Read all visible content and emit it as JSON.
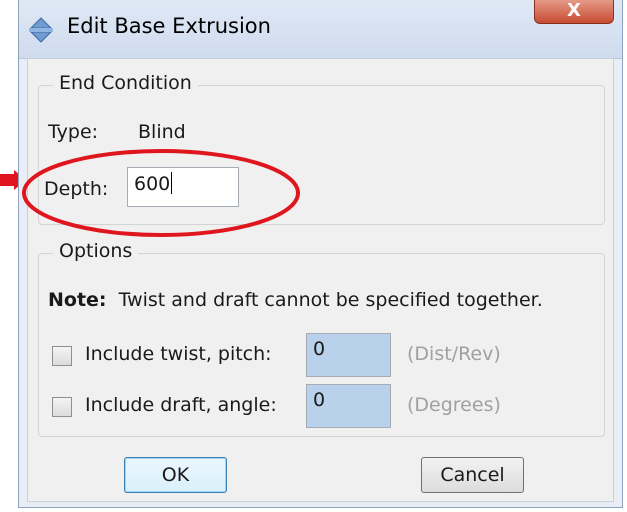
{
  "window": {
    "title": "Edit Base Extrusion",
    "close_glyph": "X",
    "icon": "extrude-icon"
  },
  "end_condition": {
    "group_label": "End Condition",
    "type_label": "Type:",
    "type_value": "Blind",
    "depth_label": "Depth:",
    "depth_value": "600"
  },
  "options": {
    "group_label": "Options",
    "note_label": "Note:",
    "note_text": "Twist and draft cannot be specified together.",
    "twist": {
      "label": "Include twist, pitch:",
      "value": "0",
      "unit": "(Dist/Rev)",
      "checked": false
    },
    "draft": {
      "label": "Include draft, angle:",
      "value": "0",
      "unit": "(Degrees)",
      "checked": false
    }
  },
  "buttons": {
    "ok_label": "OK",
    "cancel_label": "Cancel"
  },
  "colors": {
    "annotation": "#e0161f",
    "disabled_field": "#b9d1ea",
    "close_button": "#c84b33"
  }
}
